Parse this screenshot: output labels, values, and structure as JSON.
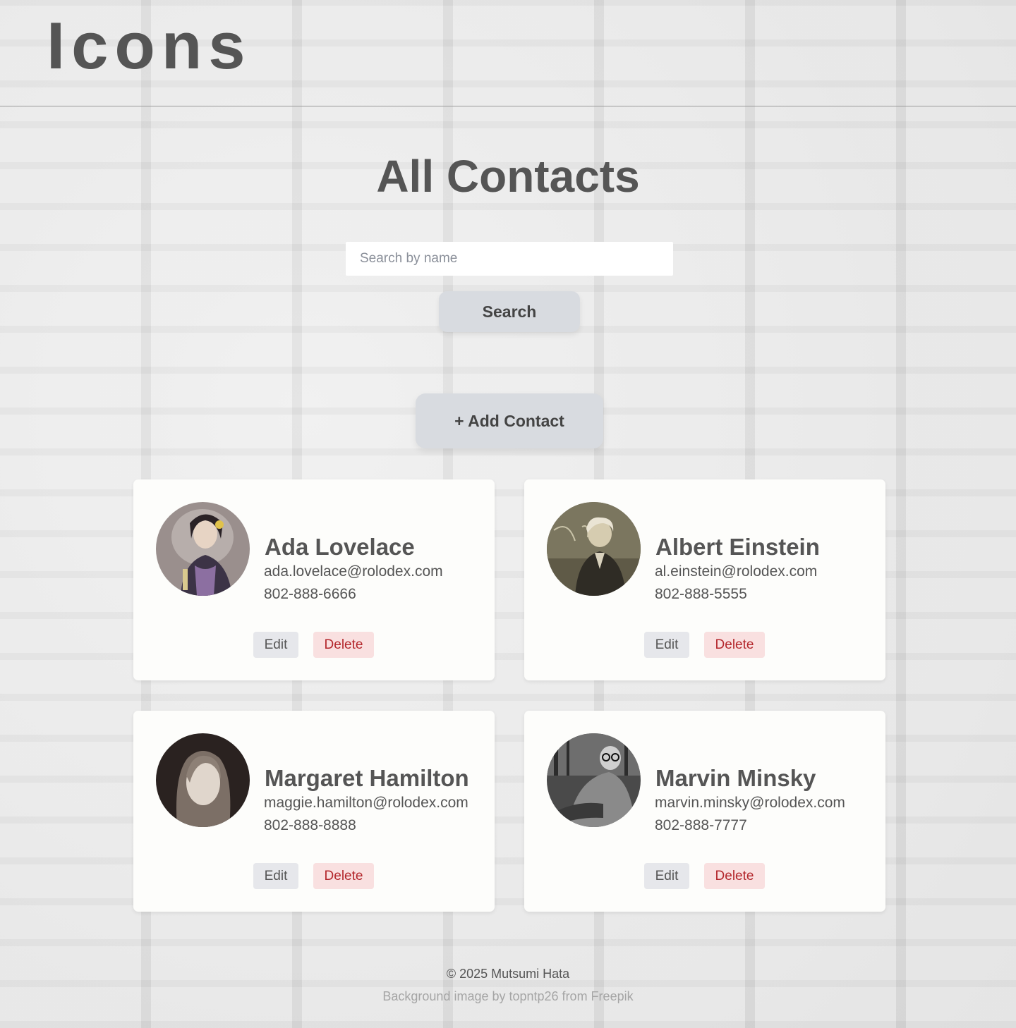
{
  "header": {
    "logo_text": "Icons"
  },
  "main": {
    "title": "All Contacts",
    "search": {
      "placeholder": "Search by name",
      "value": "",
      "button_label": "Search"
    },
    "add_contact_label": "+ Add Contact"
  },
  "contacts": [
    {
      "name": "Ada Lovelace",
      "email": "ada.lovelace@rolodex.com",
      "phone": "802-888-6666",
      "avatar": "portrait-ada-lovelace",
      "edit_label": "Edit",
      "delete_label": "Delete"
    },
    {
      "name": "Albert Einstein",
      "email": "al.einstein@rolodex.com",
      "phone": "802-888-5555",
      "avatar": "portrait-albert-einstein",
      "edit_label": "Edit",
      "delete_label": "Delete"
    },
    {
      "name": "Margaret Hamilton",
      "email": "maggie.hamilton@rolodex.com",
      "phone": "802-888-8888",
      "avatar": "portrait-margaret-hamilton",
      "edit_label": "Edit",
      "delete_label": "Delete"
    },
    {
      "name": "Marvin Minsky",
      "email": "marvin.minsky@rolodex.com",
      "phone": "802-888-7777",
      "avatar": "portrait-marvin-minsky",
      "edit_label": "Edit",
      "delete_label": "Delete"
    }
  ],
  "footer": {
    "copyright": "© 2025 Mutsumi Hata",
    "credit": "Background image by topntp26 from Freepik"
  },
  "colors": {
    "text": "#555555",
    "card_background": "#fdfdfb",
    "button_background": "#d8dbe0",
    "delete_text": "#b3262b",
    "delete_background": "#f9e0e0"
  }
}
